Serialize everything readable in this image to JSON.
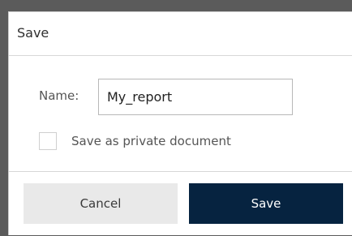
{
  "dialog": {
    "title": "Save",
    "name": {
      "label": "Name:",
      "value": "My_report"
    },
    "private_checkbox": {
      "label": "Save as private document",
      "checked": false
    },
    "buttons": {
      "cancel_label": "Cancel",
      "save_label": "Save"
    },
    "colors": {
      "primary": "#062340",
      "secondary": "#e9e9e9",
      "border": "#d7d7d7"
    }
  }
}
